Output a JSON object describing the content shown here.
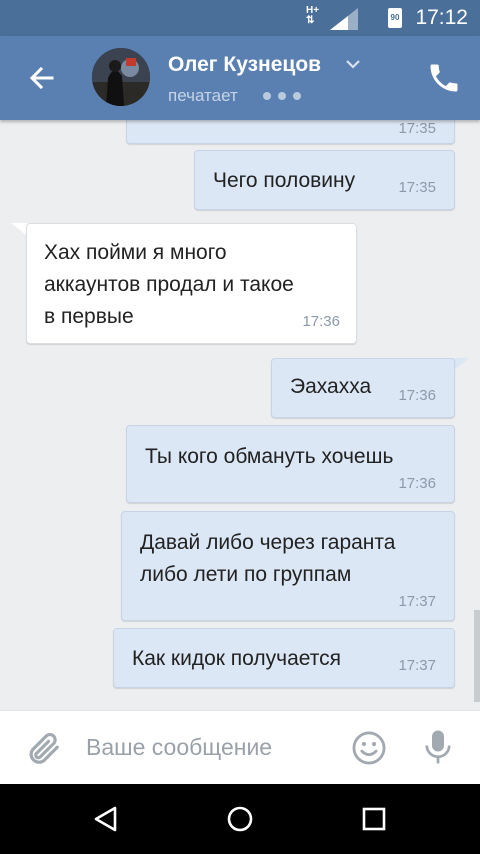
{
  "status_bar": {
    "time": "17:12",
    "battery": "90",
    "network": "H+"
  },
  "header": {
    "contact_name": "Олег Кузнецов",
    "status": "печатает"
  },
  "messages": [
    {
      "text": "",
      "time": "17:35"
    },
    {
      "text": "Чего половину",
      "time": "17:35"
    },
    {
      "text": [
        "Хах пойми я много",
        "аккаунтов продал и такое",
        "в первые"
      ],
      "time": "17:36"
    },
    {
      "text": "Эахахха",
      "time": "17:36"
    },
    {
      "text": "Ты кого обмануть хочешь",
      "time": "17:36"
    },
    {
      "text": [
        "Давай либо через гаранта",
        "либо лети по группам"
      ],
      "time": "17:37"
    },
    {
      "text": "Как кидок получается",
      "time": "17:37"
    }
  ],
  "composer": {
    "placeholder": "Ваше сообщение"
  },
  "colors": {
    "header": "#5a80b2",
    "status_bar": "#4a6f99",
    "outgoing_bubble": "#dce7f5",
    "incoming_bubble": "#ffffff",
    "background": "#edeef0"
  }
}
